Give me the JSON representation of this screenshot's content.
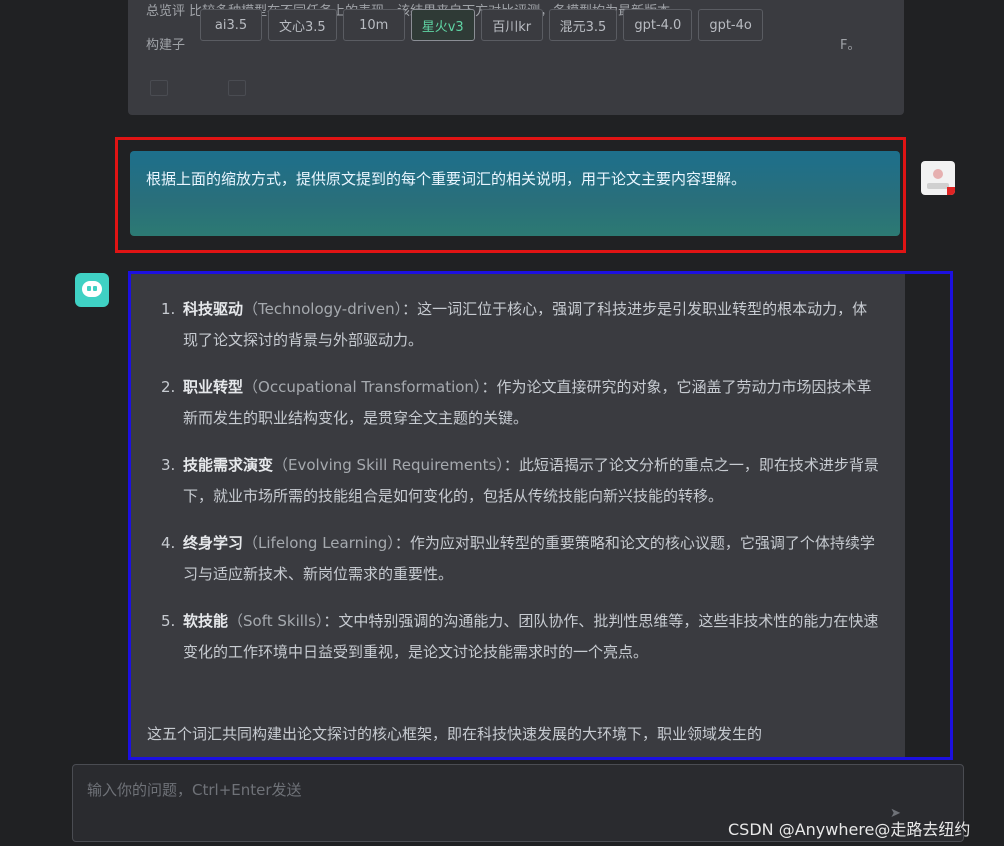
{
  "previous_message": {
    "line1": "总览评  比较多种模型在不同任务上的表现，该结果来自下方对比评测，各模型均为最新版本。",
    "line2_label": "构建子",
    "models": [
      "ai3.5",
      "文心3.5",
      "10m",
      "星火v3",
      "百川kr",
      "混元3.5",
      "gpt-4.0",
      "gpt-4o"
    ],
    "active_model": 3,
    "tail": "F。"
  },
  "user_message": {
    "text": "根据上面的缩放方式，提供原文提到的每个重要词汇的相关说明，用于论文主要内容理解。"
  },
  "bot_message": {
    "items": [
      {
        "num": "1.",
        "term": "科技驱动",
        "en": "（Technology-driven）",
        "desc": "：这一词汇位于核心，强调了科技进步是引发职业转型的根本动力，体现了论文探讨的背景与外部驱动力。"
      },
      {
        "num": "2.",
        "term": "职业转型",
        "en": "（Occupational Transformation）",
        "desc": "：作为论文直接研究的对象，它涵盖了劳动力市场因技术革新而发生的职业结构变化，是贯穿全文主题的关键。"
      },
      {
        "num": "3.",
        "term": "技能需求演变",
        "en": "（Evolving Skill Requirements）",
        "desc": "：此短语揭示了论文分析的重点之一，即在技术进步背景下，就业市场所需的技能组合是如何变化的，包括从传统技能向新兴技能的转移。"
      },
      {
        "num": "4.",
        "term": "终身学习",
        "en": "（Lifelong Learning）",
        "desc": "：作为应对职业转型的重要策略和论文的核心议题，它强调了个体持续学习与适应新技术、新岗位需求的重要性。"
      },
      {
        "num": "5.",
        "term": "软技能",
        "en": "（Soft Skills）",
        "desc": "：文中特别强调的沟通能力、团队协作、批判性思维等，这些非技术性的能力在快速变化的工作环境中日益受到重视，是论文讨论技能需求时的一个亮点。"
      }
    ],
    "summary": "这五个词汇共同构建出论文探讨的核心框架，即在科技快速发展的大环境下，职业领域发生的"
  },
  "input": {
    "placeholder": "输入你的问题，Ctrl+Enter发送"
  },
  "watermark": "CSDN @Anywhere@走路去纽约",
  "colors": {
    "page_bg": "#202123",
    "message_bg": "#3a3b40",
    "user_bubble": "#1d6f8c",
    "user_frame": "#e01414",
    "bot_frame": "#1c10e0",
    "bot_avatar": "#3fd1c4"
  }
}
